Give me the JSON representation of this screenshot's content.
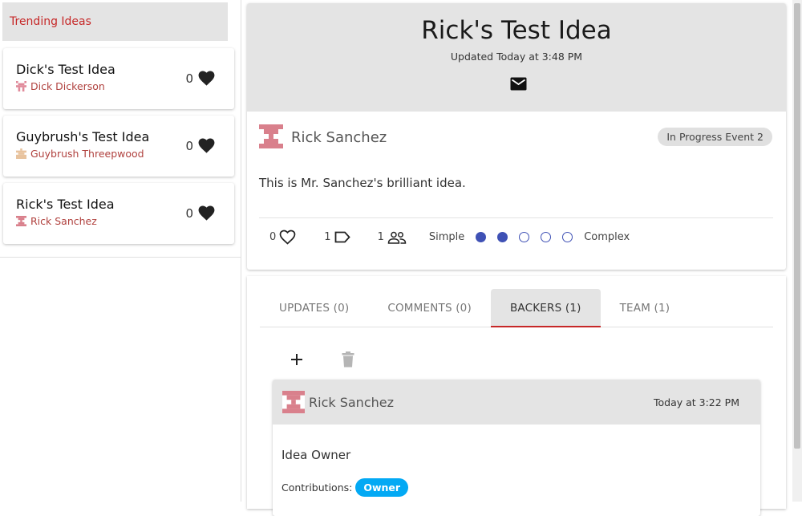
{
  "sidebar": {
    "header": "Trending Ideas",
    "ideas": [
      {
        "title": "Dick's Test Idea",
        "author": "Dick Dickerson",
        "likes": "0"
      },
      {
        "title": "Guybrush's Test Idea",
        "author": "Guybrush Threepwood",
        "likes": "0"
      },
      {
        "title": "Rick's Test Idea",
        "author": "Rick Sanchez",
        "likes": "0"
      }
    ]
  },
  "idea": {
    "title": "Rick's Test Idea",
    "updated": "Updated  Today at 3:48 PM",
    "author": "Rick Sanchez",
    "status": "In Progress Event 2",
    "description": "This is Mr. Sanchez's brilliant idea.",
    "likes": "0",
    "tags": "1",
    "backers": "1",
    "complexity_low": "Simple",
    "complexity_high": "Complex",
    "complexity_level": 2,
    "complexity_max": 5
  },
  "tabs": [
    {
      "label": "UPDATES (0)",
      "active": false
    },
    {
      "label": "COMMENTS (0)",
      "active": false
    },
    {
      "label": "BACKERS (1)",
      "active": true
    },
    {
      "label": "TEAM (1)",
      "active": false
    }
  ],
  "backer": {
    "name": "Rick Sanchez",
    "time": "Today at 3:22 PM",
    "role": "Idea Owner",
    "contributions_label": "Contributions:",
    "contribution": "Owner"
  },
  "colors": {
    "accent": "#c62828",
    "complexity": "#3f51b5",
    "pill": "#03a9f4",
    "header_bg": "#e4e4e4"
  }
}
